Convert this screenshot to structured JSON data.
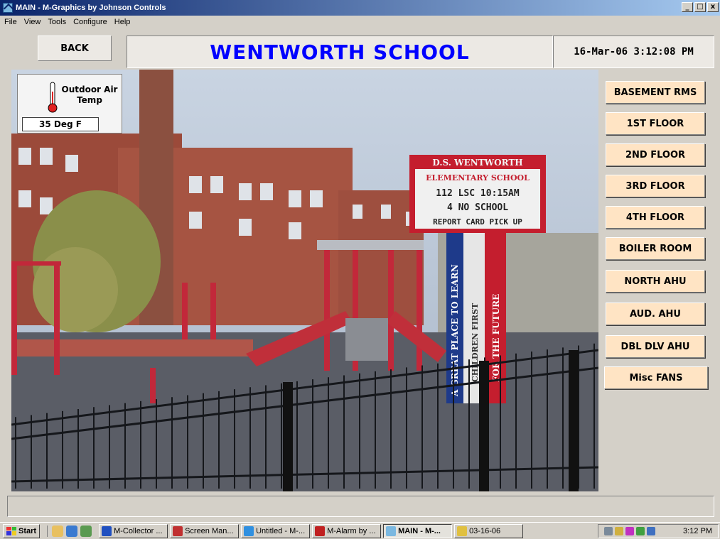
{
  "window": {
    "title": "MAIN - M-Graphics by Johnson Controls",
    "controls": [
      "_",
      "□",
      "x"
    ]
  },
  "menu": [
    "File",
    "View",
    "Tools",
    "Configure",
    "Help"
  ],
  "header": {
    "back_label": "BACK",
    "title": "WENTWORTH SCHOOL",
    "datetime": "16-Mar-06 3:12:08 PM",
    "title_color": "#0000ff"
  },
  "outdoor": {
    "label": "Outdoor Air Temp",
    "value": "35 Deg F"
  },
  "nav": [
    {
      "label": "BASEMENT RMS"
    },
    {
      "label": "1ST FLOOR"
    },
    {
      "label": "2ND FLOOR"
    },
    {
      "label": "3RD FLOOR"
    },
    {
      "label": "4TH FLOOR"
    },
    {
      "label": "BOILER ROOM"
    },
    {
      "label": "NORTH AHU"
    },
    {
      "label": "AUD. AHU"
    },
    {
      "label": "DBL DLV AHU"
    },
    {
      "label": "Misc FANS"
    }
  ],
  "sign": {
    "line1": "D.S. WENTWORTH",
    "line2": "ELEMENTARY SCHOOL",
    "line3": "112 LSC 10:15AM",
    "line4": "4 NO SCHOOL",
    "line5": "REPORT CARD PICK UP",
    "pillar_left": "A GREAT PLACE TO LEARN",
    "pillar_mid": "CHILDREN FIRST",
    "pillar_right": "FOR THE FUTURE"
  },
  "taskbar": {
    "start_label": "Start",
    "tasks": [
      {
        "label": "M-Collector ...",
        "active": false,
        "color": "#2050c0"
      },
      {
        "label": "Screen Man...",
        "active": false,
        "color": "#c03030"
      },
      {
        "label": "Untitled - M-...",
        "active": false,
        "color": "#3090e0"
      },
      {
        "label": "M-Alarm by ...",
        "active": false,
        "color": "#c02020"
      },
      {
        "label": "MAIN - M-...",
        "active": true,
        "color": "#7bb8e0"
      },
      {
        "label": "03-16-06",
        "active": false,
        "color": "#e0c040"
      }
    ],
    "clock": "3:12 PM"
  }
}
